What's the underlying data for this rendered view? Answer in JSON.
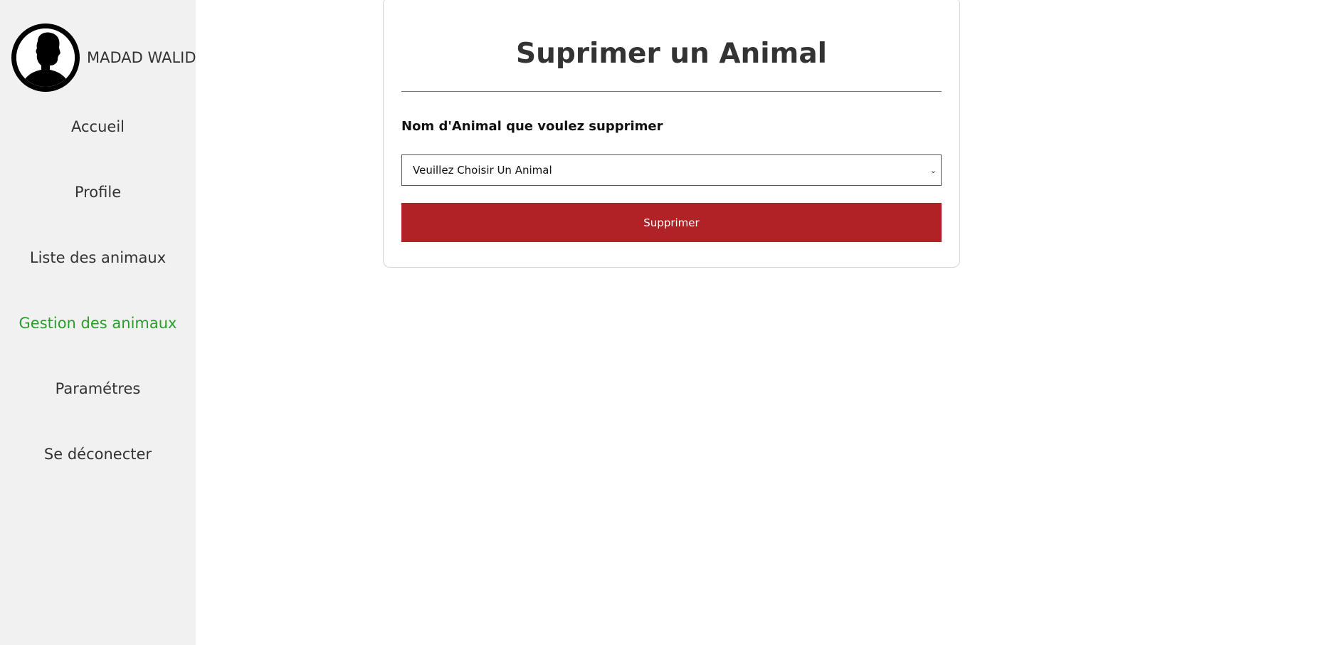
{
  "sidebar": {
    "user_name": "MADAD WALID",
    "items": [
      {
        "label": "Accueil",
        "active": false
      },
      {
        "label": "Profile",
        "active": false
      },
      {
        "label": "Liste des animaux",
        "active": false
      },
      {
        "label": "Gestion des animaux",
        "active": true
      },
      {
        "label": "Paramétres",
        "active": false
      },
      {
        "label": "Se déconecter",
        "active": false
      }
    ],
    "active_color": "#2a9d2a",
    "background": "#f1f1f1"
  },
  "form": {
    "title": "Suprimer un Animal",
    "label": "Nom d'Animal que voulez supprimer",
    "select_value": "Veuillez Choisir Un Animal",
    "submit_label": "Supprimer",
    "submit_color": "#b02226"
  },
  "icons": {
    "avatar": "user-silhouette-icon",
    "select_arrow": "chevron-down-icon"
  }
}
